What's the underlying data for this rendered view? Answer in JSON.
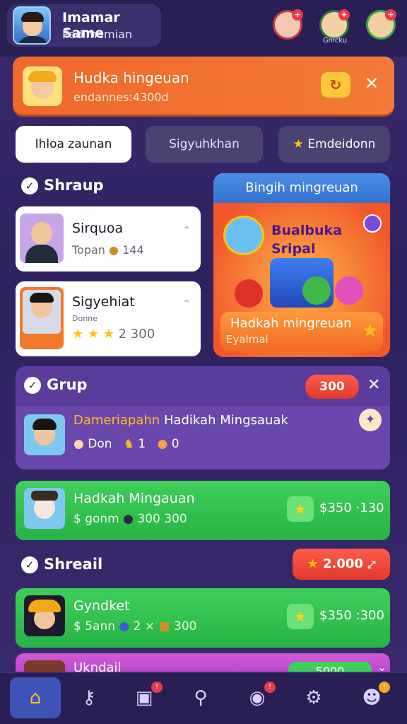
{
  "header": {
    "name": "Imamar Same",
    "subtitle": "Pedlmemian",
    "friend_caption": "Gnicku"
  },
  "banner": {
    "title": "Hudka hingeuan",
    "subtitle": "endannes:4300d"
  },
  "tabs": [
    {
      "label": "Ihloa zaunan"
    },
    {
      "label": "Sigyuhkhan"
    },
    {
      "label": "Emdeidonn"
    }
  ],
  "section_shraup": {
    "label": "Shraup",
    "cards": [
      {
        "title": "Sirquoa",
        "stat": "Topan",
        "value": "144"
      },
      {
        "title": "Sigyehiat",
        "stat": "Donne",
        "value": "2 300"
      }
    ]
  },
  "promo": {
    "header": "Bingih mingreuan",
    "big1": "Bualbuka",
    "big2": "Sripal",
    "footer_title": "Hadkah mingreuan",
    "footer_sub": "Eyalmal"
  },
  "group": {
    "label": "Grup",
    "pill": "300",
    "row_title_hl": "Dameriapahn",
    "row_title": "Hadikah Mingsauak",
    "row_stat1": "Don",
    "row_stat2": "1",
    "row_stat3": "0"
  },
  "green_rows": [
    {
      "title": "Hadkah Mingauan",
      "sub": "$ gonm",
      "sub_value": "300 300",
      "amount": "$350 ·130"
    },
    {
      "title": "Gyndket",
      "sub": "$ 5ann",
      "sub_value": "300",
      "sub_mult": "2 ×",
      "amount": "$350 :300"
    }
  ],
  "section_shreail": {
    "label": "Shreail",
    "pill": "2.000"
  },
  "bottom_row": {
    "title": "Ukndail",
    "pill": "5000"
  },
  "nav": [
    {
      "icon": "home-icon"
    },
    {
      "icon": "key-icon"
    },
    {
      "icon": "calendar-icon"
    },
    {
      "icon": "search-icon"
    },
    {
      "icon": "profile-badge-icon"
    },
    {
      "icon": "gear-icon"
    },
    {
      "icon": "user-icon"
    }
  ]
}
